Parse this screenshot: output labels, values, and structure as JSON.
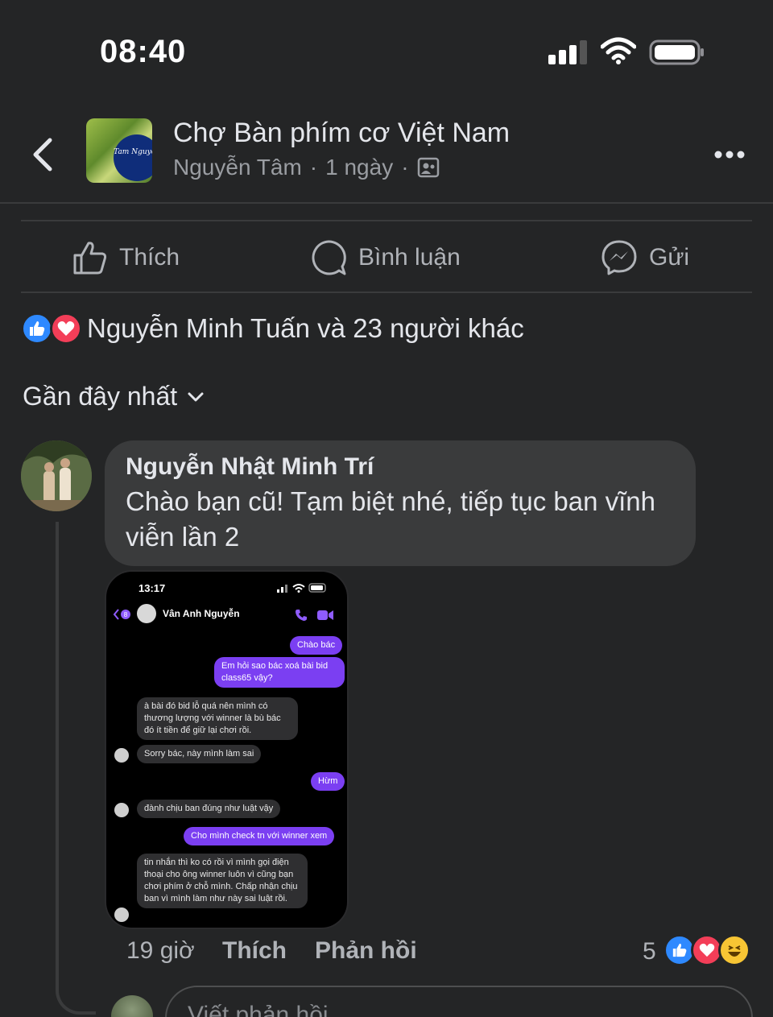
{
  "status_bar": {
    "time": "08:40"
  },
  "header": {
    "group_name": "Chợ Bàn phím cơ Việt Nam",
    "author": "Nguyễn Tâm",
    "separator": "·",
    "post_age": "1 ngày",
    "avatar_badge": "Tam Nguyen"
  },
  "actions": {
    "like_label": "Thích",
    "comment_label": "Bình luận",
    "send_label": "Gửi"
  },
  "reactions": {
    "summary": "Nguyễn Minh Tuấn và 23 người khác"
  },
  "sort": {
    "label": "Gần đây nhất"
  },
  "comment": {
    "author": "Nguyễn Nhật Minh Trí",
    "text": "Chào bạn cũ! Tạm biệt nhé, tiếp tục ban vĩnh viễn lần 2",
    "time": "19 giờ",
    "like_label": "Thích",
    "reply_label": "Phản hồi",
    "reaction_count": "5",
    "screenshot": {
      "time": "13:17",
      "contact_name": "Vân Anh Nguyễn",
      "back_count": "8",
      "messages": [
        {
          "dir": "out",
          "text": "Chào bác"
        },
        {
          "dir": "out",
          "text": "Em hỏi sao bác xoá bài bid class65 vậy?"
        },
        {
          "dir": "in",
          "text": "à bài đó bid lỗ quá nên mình có thương lượng với winner là bù bác đó ít tiền để giữ lại chơi rồi."
        },
        {
          "dir": "in",
          "text": "Sorry bác, này mình làm sai"
        },
        {
          "dir": "out",
          "text": "Hừm"
        },
        {
          "dir": "in",
          "text": "đành chịu ban đúng như luật vậy"
        },
        {
          "dir": "out",
          "text": "Cho mình check tn với winner xem"
        },
        {
          "dir": "in",
          "text": "tin nhắn thì ko có rồi vì mình gọi điện thoại cho ông winner luôn vì cũng bạn chơi phím ở chỗ mình. Chấp nhận chịu ban vì mình làm như này sai luật rồi."
        }
      ]
    }
  },
  "composer": {
    "placeholder": "Viết phản hồi..."
  },
  "colors": {
    "background": "#242526",
    "bubble": "#3a3b3c",
    "like_blue": "#2e89ff",
    "love_red": "#f33e58",
    "messenger_purple": "#7b3ff2"
  }
}
